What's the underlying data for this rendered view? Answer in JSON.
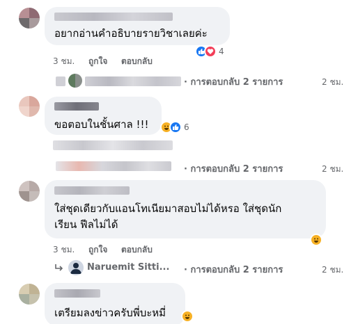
{
  "comments": [
    {
      "text": "อยากอ่านคำอธิบายรายวิชาเลยค่ะ",
      "reaction_count": "4",
      "time": "3 ชม.",
      "like_label": "ถูกใจ",
      "reply_label": "ตอบกลับ",
      "replies_label": "· การตอบกลับ 2 รายการ",
      "replies_time": "2 ชม."
    },
    {
      "text": "ขอตอบในชั้นศาล !!!",
      "reaction_count": "6",
      "replies_label": "· การตอบกลับ 2 รายการ",
      "replies_time": "2 ชม."
    },
    {
      "text_line1": "ใส่ชุดเดียวกับแอนโทเนียมาสอบไม่ได้หรอ ใส่ชุดนัก",
      "text_line2": "เรียน ฟีลไม่ได้",
      "time": "3 ชม.",
      "like_label": "ถูกใจ",
      "reply_label": "ตอบกลับ",
      "reply_author": "Naruemit Sitti...",
      "replies_label": "· การตอบกลับ 2 รายการ",
      "replies_time": "2 ชม."
    },
    {
      "text": "เตรียมลงข่าวครับพี่บะหมี่"
    }
  ],
  "icons": {
    "like": "like-icon",
    "love": "heart-icon",
    "haha": "haha-icon",
    "reply": "reply-arrow-icon"
  },
  "colors": {
    "bubble": "#f0f2f5",
    "meta": "#65676b",
    "like_blue": "#1877f2",
    "love_red": "#f33e58",
    "haha_yellow": "#f7b125"
  }
}
